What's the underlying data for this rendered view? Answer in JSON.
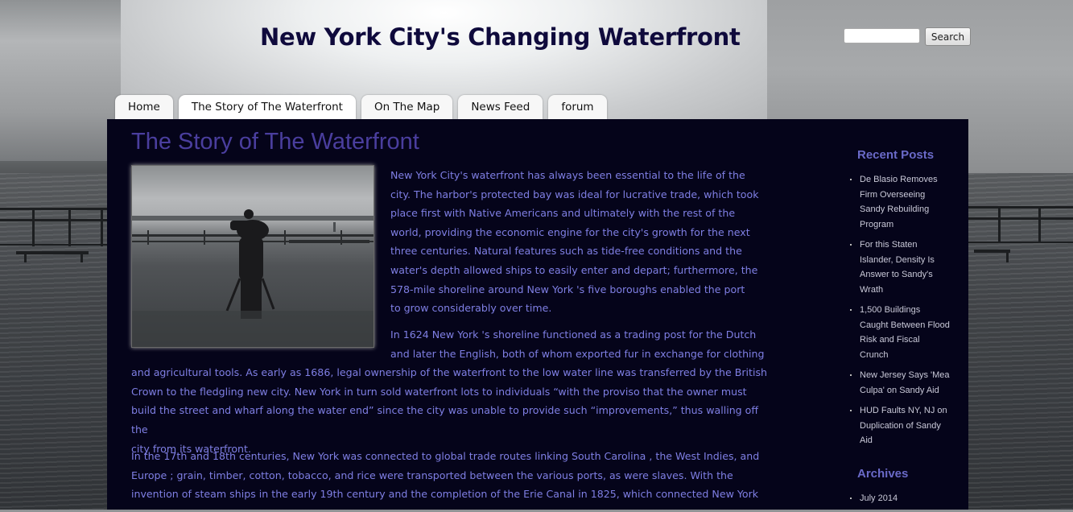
{
  "site": {
    "title": "New York City's Changing Waterfront"
  },
  "search": {
    "placeholder": "",
    "button_label": "Search"
  },
  "nav": {
    "tabs": [
      {
        "label": "Home"
      },
      {
        "label": "The Story of The Waterfront"
      },
      {
        "label": "On The Map"
      },
      {
        "label": "News Feed"
      },
      {
        "label": "forum"
      }
    ]
  },
  "article": {
    "title": "The Story of The Waterfront",
    "p1_lines": [
      "New York City's waterfront has always been essential to the life of the",
      "city. The harbor's protected bay was ideal for lucrative trade, which took",
      "place first with Native Americans and ultimately with the rest of the",
      "world, providing the economic engine for the city's growth for the next",
      "three centuries. Natural features such as tide-free conditions and the",
      "water's depth allowed ships to easily enter and depart; furthermore, the",
      "578-mile shoreline around New York 's five boroughs enabled the port",
      "to grow considerably over time."
    ],
    "p2_lines_short": [
      "In 1624 New York 's shoreline functioned as a trading post for the Dutch",
      "and later the English, both of whom exported fur in exchange for clothing"
    ],
    "p2_lines_full": [
      "and agricultural tools. As early as 1686, legal ownership of the waterfront to the low water line was transferred by the British",
      "Crown to the fledgling new city. New York in turn sold waterfront lots to individuals “with the proviso that the owner must",
      "build the street and wharf along the water end” since the city was unable to provide such “improvements,” thus walling off the",
      "city from its waterfront."
    ],
    "p3_lines": [
      "In the 17th and 18th centuries, New York was connected to global trade routes linking South Carolina , the West Indies, and",
      "Europe ; grain, timber, cotton, tobacco, and rice were transported between the various ports, as were slaves. With the",
      "invention of steam ships in the early 19th century and the completion of the Erie Canal in 1825, which connected New York"
    ]
  },
  "sidebar": {
    "recent_heading": "Recent Posts",
    "recent_posts": [
      "De Blasio Removes Firm Overseeing Sandy Rebuilding Program",
      "For this Staten Islander, Density Is Answer to Sandy's Wrath",
      "1,500 Buildings Caught Between Flood Risk and Fiscal Crunch",
      "New Jersey Says 'Mea Culpa' on Sandy Aid",
      "HUD Faults NY, NJ on Duplication of Sandy Aid"
    ],
    "archives_heading": "Archives",
    "archives": [
      "July 2014"
    ]
  }
}
